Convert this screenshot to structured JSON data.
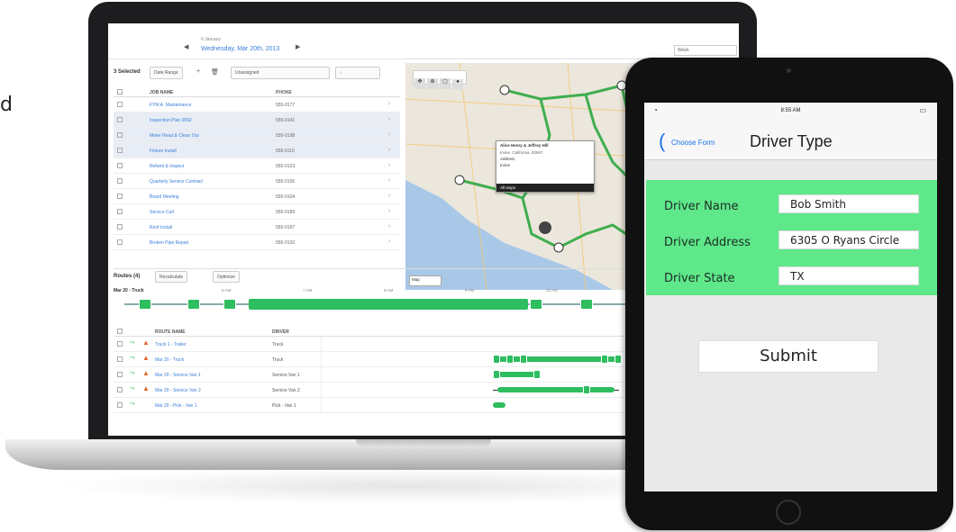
{
  "edge_text": "d",
  "laptop": {
    "app": {
      "date_small": "6 January",
      "date_big": "Wednesday, Mar 20th, 2013",
      "view_select": "Week",
      "toolbar": {
        "selected_label": "3 Selected",
        "date_range_label": "Date Range",
        "filter_select": "Unassigned"
      },
      "jobs": {
        "headers": [
          "JOB NAME",
          "PHONE"
        ],
        "rows": [
          {
            "name": "FYM A. Maintenance",
            "phone": "555-0177"
          },
          {
            "name": "Inspection Plan 0092",
            "phone": "555-0141"
          },
          {
            "name": "Meter Read & Clean Out",
            "phone": "555-0198"
          },
          {
            "name": "Fixture Install",
            "phone": "555-0110"
          },
          {
            "name": "Refund & Inspect",
            "phone": "555-0123"
          },
          {
            "name": "Quarterly Service Contract",
            "phone": "555-0156"
          },
          {
            "name": "Board Meeting",
            "phone": "555-0104"
          },
          {
            "name": "Service Call",
            "phone": "555-0189"
          },
          {
            "name": "Roof Install",
            "phone": "555-0167"
          },
          {
            "name": "Broken Pipe Repair",
            "phone": "555-0132"
          }
        ]
      },
      "map": {
        "popup_title": "Alice Henry & Jeffrey Hill",
        "popup_sub": "Irvine, California, 92697",
        "popup_line1": "Address",
        "popup_line2": "Irvine",
        "popup_button": "All stops",
        "legend": "Map"
      },
      "routes": {
        "label": "Routes (4)",
        "btn1": "Recalculate",
        "btn2": "Optimize",
        "timeline_route": "Mar 20 - Truck",
        "ticks": [
          "6 AM",
          "7 AM",
          "8 AM",
          "9 AM",
          "10 AM",
          "11 AM",
          "12 PM"
        ],
        "headers": [
          "ROUTE NAME",
          "DRIVER"
        ],
        "rows": [
          {
            "name": "Truck 1 - Trailer",
            "driver": "Truck"
          },
          {
            "name": "Mar 20 - Truck",
            "driver": "Truck"
          },
          {
            "name": "Mar 20 - Service Van 1",
            "driver": "Service Van 1"
          },
          {
            "name": "Mar 20 - Service Van 2",
            "driver": "Service Van 2"
          },
          {
            "name": "Mar 20 - Pick - Van 1",
            "driver": "Pick - Van 1"
          }
        ]
      }
    }
  },
  "ipad": {
    "status": {
      "time": "8:55 AM"
    },
    "nav": {
      "back_label": "Choose Form",
      "title": "Driver Type"
    },
    "form": {
      "fields": [
        {
          "label": "Driver Name",
          "value": "Bob Smith"
        },
        {
          "label": "Driver Address",
          "value": "6305 O Ryans Circle"
        },
        {
          "label": "Driver State",
          "value": "TX"
        }
      ]
    },
    "submit_label": "Submit"
  },
  "colors": {
    "form_green": "#5ee88a",
    "route_green": "#2ebd5f",
    "link_blue": "#3b7dd8",
    "ios_blue": "#1a73e8"
  }
}
